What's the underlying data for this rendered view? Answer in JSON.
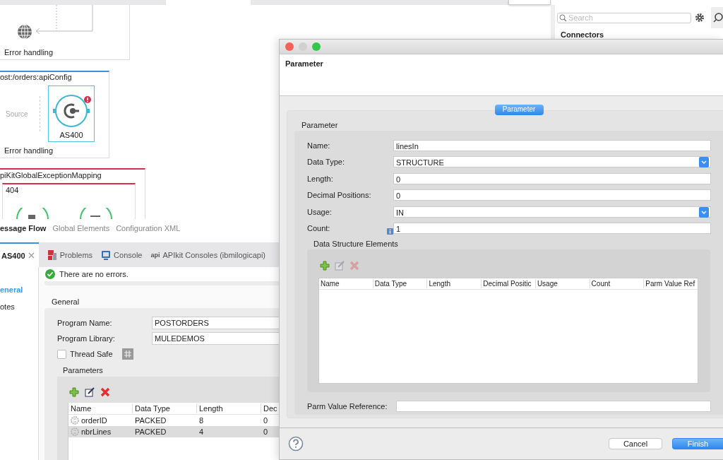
{
  "canvas": {
    "flows": [
      {
        "kind": "plain",
        "footer": "Error handling"
      },
      {
        "kind": "api",
        "title": "ost:/orders:apiConfig",
        "source": "Source",
        "node": {
          "label": "AS400",
          "error": true
        },
        "footer": "Error handling"
      },
      {
        "kind": "exception",
        "title": "piKitGlobalExceptionMapping",
        "inner_title": "404"
      }
    ]
  },
  "editor_tabs": [
    {
      "label": "essage Flow",
      "selected": true
    },
    {
      "label": "Global Elements",
      "selected": false
    },
    {
      "label": "Configuration XML",
      "selected": false
    }
  ],
  "palette": {
    "search": {
      "placeholder": "Search"
    },
    "heading": "Connectors"
  },
  "panel": {
    "tabs": [
      {
        "kind": "editor",
        "label": "AS400",
        "selected": true
      },
      {
        "kind": "problems",
        "label": "Problems",
        "selected": false
      },
      {
        "kind": "console",
        "label": "Console",
        "selected": false
      },
      {
        "kind": "api",
        "icon_text": "api",
        "label": "APIkit Consoles (ibmilogicapi)",
        "selected": false
      }
    ],
    "nav": [
      {
        "label": "eneral",
        "selected": true
      },
      {
        "label": "otes",
        "selected": false
      }
    ],
    "message": "There are no errors.",
    "section": "General",
    "fields": [
      {
        "label": "Program Name:",
        "value": "POSTORDERS"
      },
      {
        "label": "Program Library:",
        "value": "MULEDEMOS"
      }
    ],
    "thread_safe": {
      "label": "Thread Safe",
      "checked": false
    },
    "parameters": {
      "title": "Parameters",
      "columns": [
        "Name",
        "Data Type",
        "Length",
        "Dec"
      ],
      "rows": [
        {
          "cells": [
            "orderID",
            "PACKED",
            "8",
            "0"
          ],
          "selected": false
        },
        {
          "cells": [
            "nbrLines",
            "PACKED",
            "4",
            "0"
          ],
          "selected": true
        }
      ]
    }
  },
  "dialog": {
    "title": "Parameter",
    "tab": "Parameter",
    "group": "Parameter",
    "fields": [
      {
        "kind": "text",
        "label": "Name:",
        "value": "linesIn"
      },
      {
        "kind": "dropdown",
        "label": "Data Type:",
        "value": "STRUCTURE"
      },
      {
        "kind": "text",
        "label": "Length:",
        "value": "0"
      },
      {
        "kind": "text",
        "label": "Decimal Positions:",
        "value": "0"
      },
      {
        "kind": "dropdown",
        "label": "Usage:",
        "value": "IN"
      },
      {
        "kind": "text",
        "label": "Count:",
        "value": "1",
        "info": true
      }
    ],
    "elements": {
      "title": "Data Structure Elements",
      "tools": [
        {
          "kind": "add",
          "disabled": false
        },
        {
          "kind": "edit",
          "disabled": true
        },
        {
          "kind": "delete",
          "disabled": true
        }
      ],
      "columns": [
        "Name",
        "Data Type",
        "Length",
        "Decimal Positic",
        "Usage",
        "Count",
        "Parm Value Ref"
      ]
    },
    "reference": {
      "label": "Parm Value Reference:"
    },
    "buttons": [
      {
        "kind": "secondary",
        "label": "Cancel"
      },
      {
        "kind": "primary",
        "label": "Finish"
      }
    ]
  }
}
